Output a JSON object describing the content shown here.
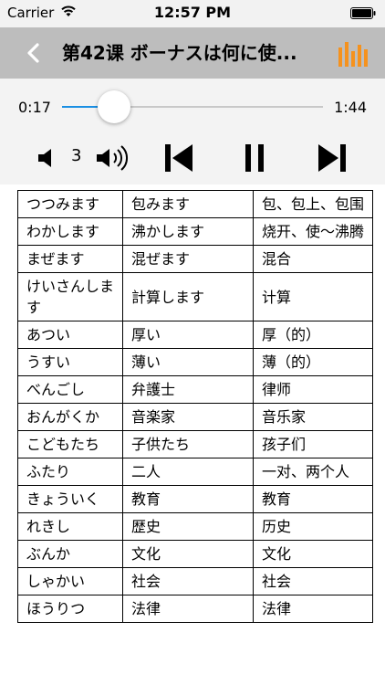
{
  "status_bar": {
    "carrier": "Carrier",
    "time": "12:57 PM"
  },
  "nav": {
    "title": "第42课 ボーナスは何に使...",
    "accent_color": "#f5921e"
  },
  "player": {
    "current_time": "0:17",
    "duration": "1:44",
    "progress": 0.2,
    "volume": "3",
    "progress_color": "#1a8fe3"
  },
  "vocab": {
    "rows": [
      {
        "kana": "つつみます",
        "kanji": "包みます",
        "meaning": "包、包上、包围"
      },
      {
        "kana": "わかします",
        "kanji": "沸かします",
        "meaning": "烧开、使～沸腾"
      },
      {
        "kana": "まぜます",
        "kanji": "混ぜます",
        "meaning": "混合"
      },
      {
        "kana": "けいさんします",
        "kanji": "計算します",
        "meaning": "计算"
      },
      {
        "kana": "あつい",
        "kanji": "厚い",
        "meaning": "厚（的）"
      },
      {
        "kana": "うすい",
        "kanji": "薄い",
        "meaning": "薄（的）"
      },
      {
        "kana": "べんごし",
        "kanji": "弁護士",
        "meaning": "律师"
      },
      {
        "kana": "おんがくか",
        "kanji": "音楽家",
        "meaning": "音乐家"
      },
      {
        "kana": "こどもたち",
        "kanji": "子供たち",
        "meaning": "孩子们"
      },
      {
        "kana": "ふたり",
        "kanji": "二人",
        "meaning": "一对、两个人"
      },
      {
        "kana": "きょういく",
        "kanji": "教育",
        "meaning": "教育"
      },
      {
        "kana": "れきし",
        "kanji": "歴史",
        "meaning": "历史"
      },
      {
        "kana": "ぶんか",
        "kanji": "文化",
        "meaning": "文化"
      },
      {
        "kana": "しゃかい",
        "kanji": "社会",
        "meaning": "社会"
      },
      {
        "kana": "ほうりつ",
        "kanji": "法律",
        "meaning": "法律"
      }
    ]
  }
}
